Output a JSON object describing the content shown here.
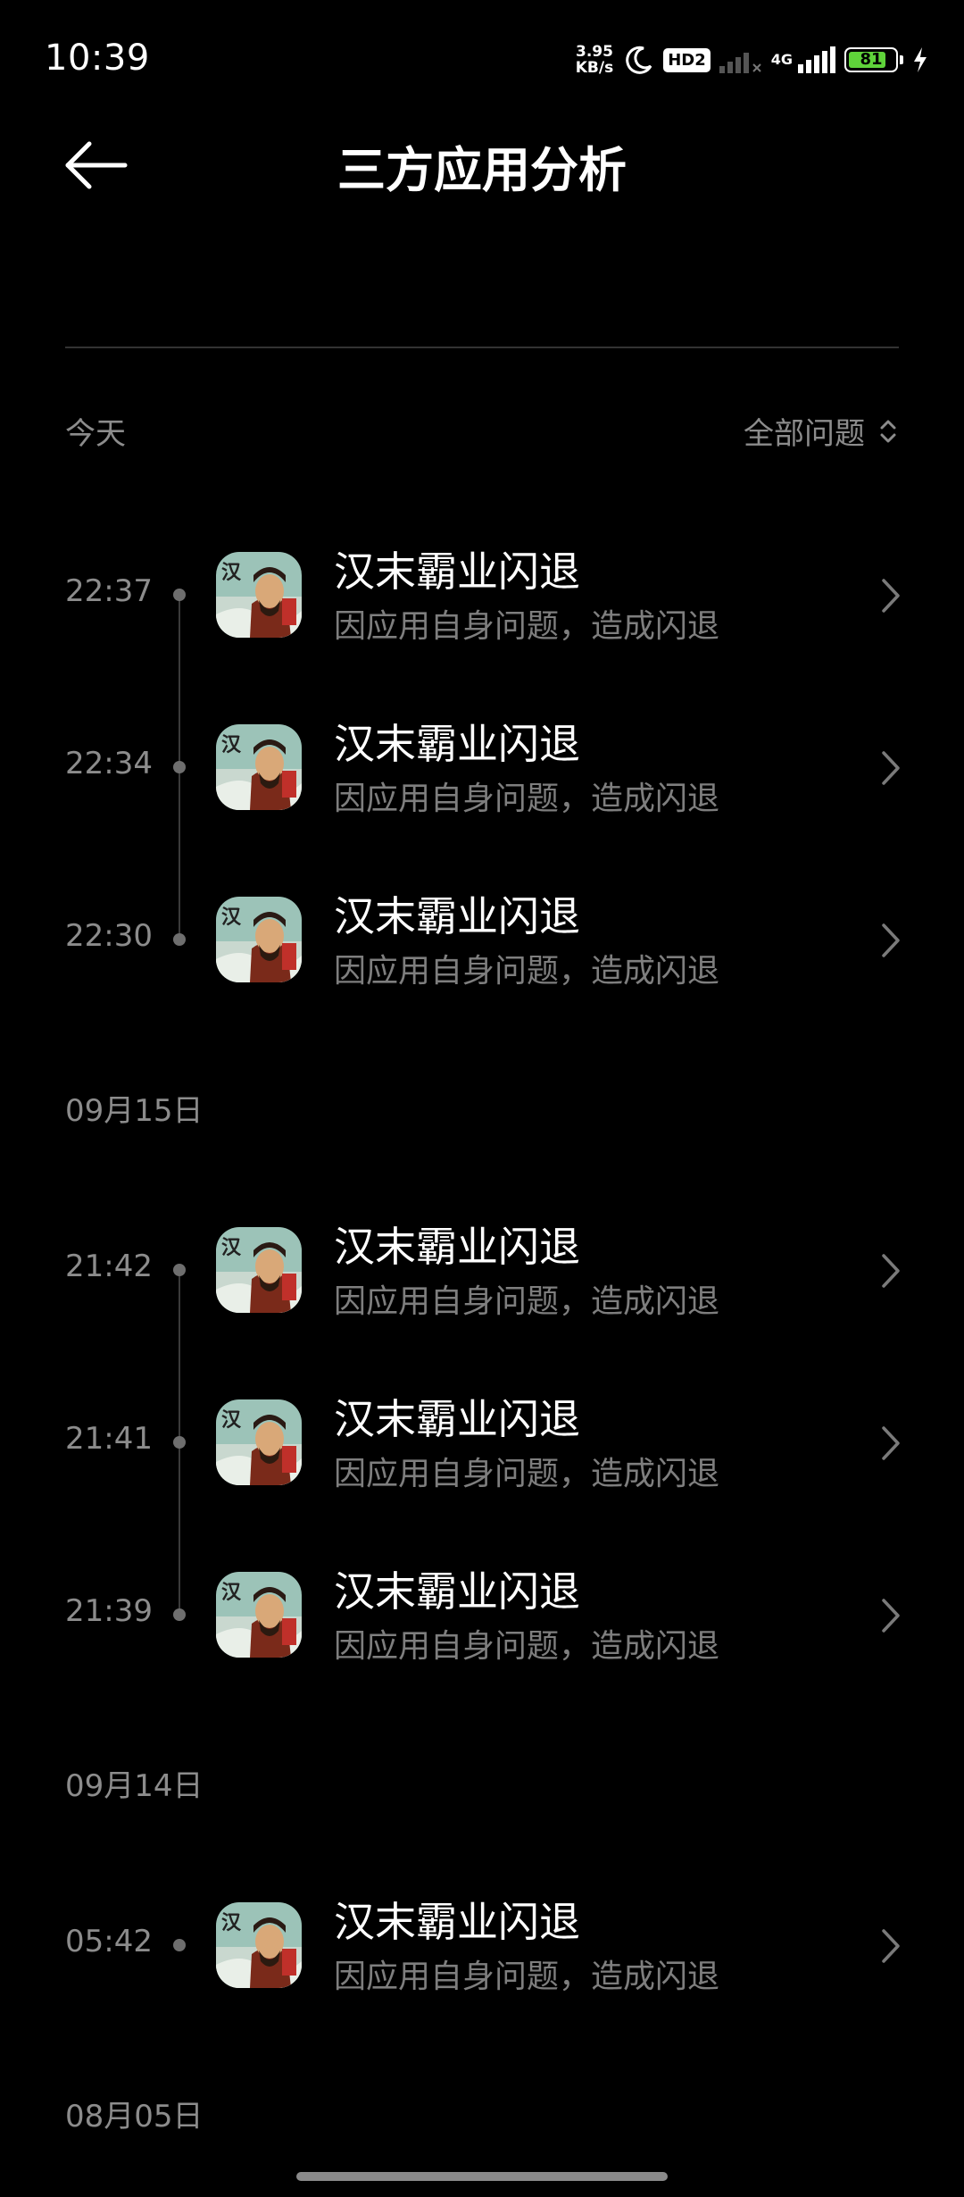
{
  "status_bar": {
    "time": "10:39",
    "net_speed_value": "3.95",
    "net_speed_unit": "KB/s",
    "hd_label": "HD2",
    "network_type": "4G",
    "battery_level": "81",
    "battery_fraction": 0.81,
    "battery_color": "#5fd33a"
  },
  "header": {
    "back_icon": "arrow-left-icon",
    "title": "三方应用分析"
  },
  "filter": {
    "label": "全部问题",
    "icon": "sort-updown-icon"
  },
  "sections": [
    {
      "date_label": "今天",
      "items": [
        {
          "time": "22:37",
          "app": "汉末霸业闪退",
          "reason": "因应用自身问题，造成闪退"
        },
        {
          "time": "22:34",
          "app": "汉末霸业闪退",
          "reason": "因应用自身问题，造成闪退"
        },
        {
          "time": "22:30",
          "app": "汉末霸业闪退",
          "reason": "因应用自身问题，造成闪退"
        }
      ]
    },
    {
      "date_label": "09月15日",
      "items": [
        {
          "time": "21:42",
          "app": "汉末霸业闪退",
          "reason": "因应用自身问题，造成闪退"
        },
        {
          "time": "21:41",
          "app": "汉末霸业闪退",
          "reason": "因应用自身问题，造成闪退"
        },
        {
          "time": "21:39",
          "app": "汉末霸业闪退",
          "reason": "因应用自身问题，造成闪退"
        }
      ]
    },
    {
      "date_label": "09月14日",
      "items": [
        {
          "time": "05:42",
          "app": "汉末霸业闪退",
          "reason": "因应用自身问题，造成闪退"
        }
      ]
    },
    {
      "date_label": "08月05日",
      "items": []
    }
  ]
}
